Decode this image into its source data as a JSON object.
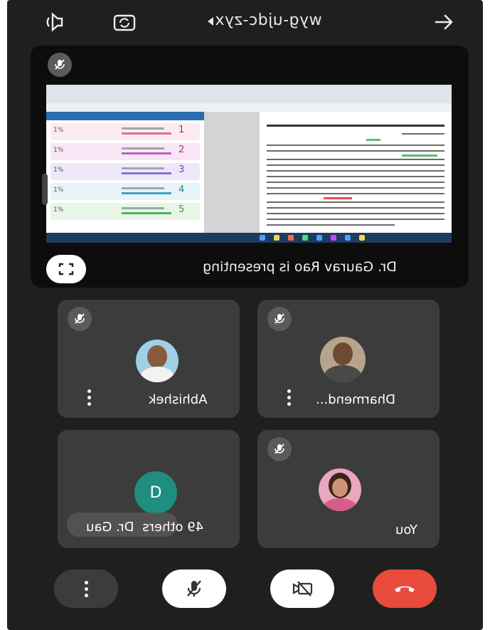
{
  "top_bar": {
    "title": "wyg-ujdc-zyx",
    "icons": [
      "speaker-icon",
      "switch-camera-icon",
      "back-arrow-icon"
    ]
  },
  "presentation": {
    "presenting_label": "Dr. Gaurav Rao is presenting",
    "shared_screen": {
      "panel_rows": [
        "1",
        "2",
        "3",
        "4",
        "5"
      ],
      "scores": [
        "1%",
        "1%",
        "1%",
        "1%",
        "1%"
      ]
    }
  },
  "participants": [
    {
      "name": "Dharmend...",
      "muted": true,
      "avatar": "photo"
    },
    {
      "name": "Abhishek",
      "muted": true,
      "avatar": "photo"
    },
    {
      "name": "You",
      "muted": true,
      "avatar": "photo"
    },
    {
      "name": "Dr. Gau",
      "others_label": "49 others",
      "avatar_letter": "D",
      "avatar_color": "#1e8e7e"
    }
  ],
  "controls": {
    "end_call_color": "#e84a3c",
    "buttons": [
      "end-call",
      "camera-off",
      "microphone-off",
      "more-options"
    ]
  },
  "colors": {
    "background": "#1f1f1f",
    "tile": "#3c3c3c",
    "badge": "#5b5b5b"
  }
}
